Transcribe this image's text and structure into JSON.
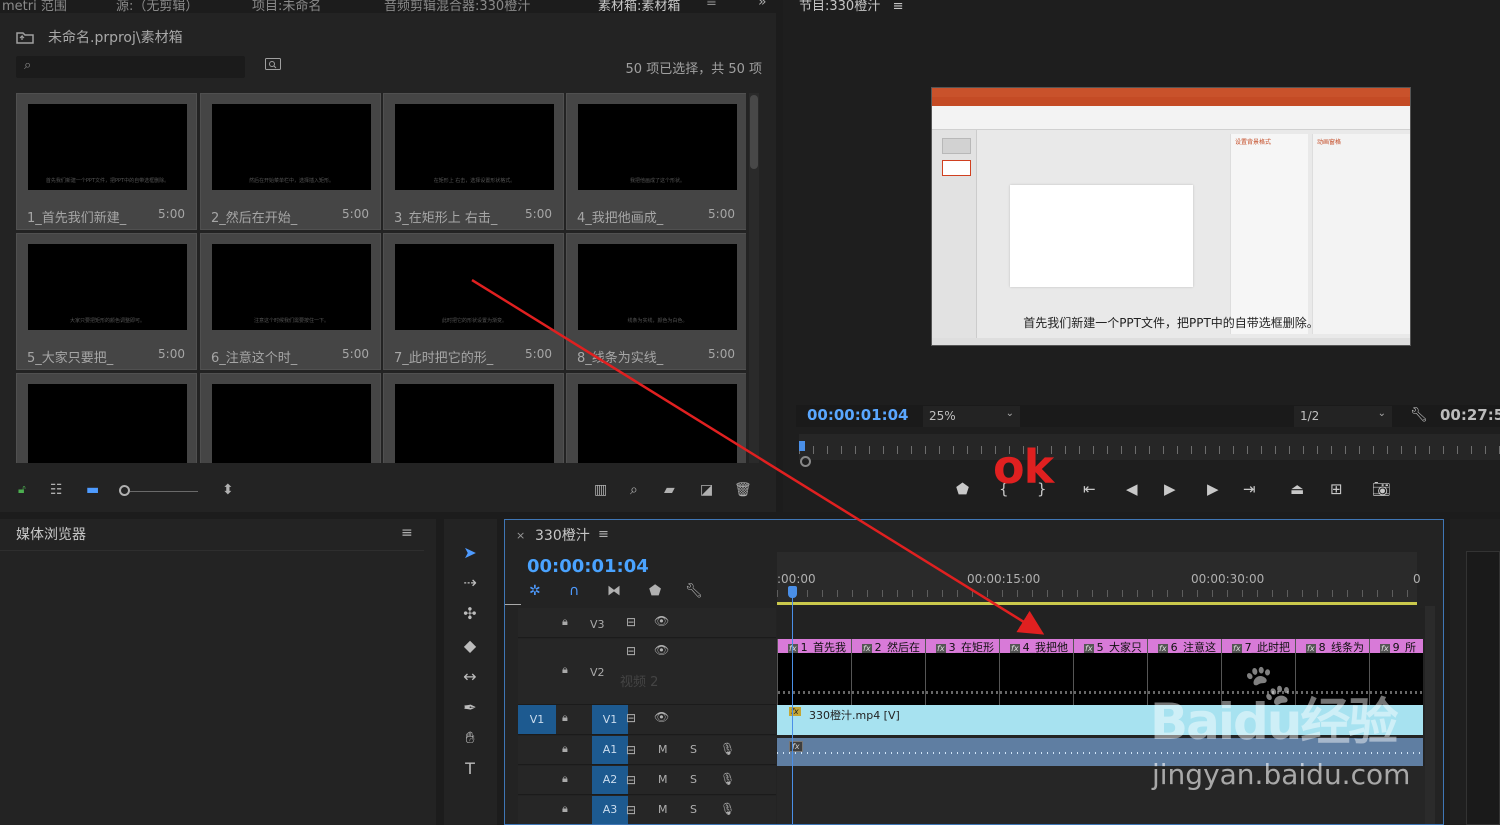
{
  "tabs": [
    {
      "label": "metri 范围"
    },
    {
      "label": "源:（无剪辑）"
    },
    {
      "label": "项目:未命名"
    },
    {
      "label": "音频剪辑混合器:330橙汁"
    },
    {
      "label": "素材箱:素材箱",
      "active": true
    }
  ],
  "tabs_more": "»",
  "tab_menu": "≡",
  "bin": {
    "path": "未命名.prproj\\素材箱",
    "count_text": "50 项已选择，共 50 项",
    "items": [
      {
        "name": "1_首先我们新建_",
        "duration": "5:00",
        "caption": "首先我们新建一个PPT文件，把PPT中的自带选框删除。"
      },
      {
        "name": "2_然后在开始_",
        "duration": "5:00",
        "caption": "然后在开始菜单栏中，选择插入矩形。"
      },
      {
        "name": "3_在矩形上 右击_",
        "duration": "5:00",
        "caption": "在矩形上 右击，选择设置形状格式。"
      },
      {
        "name": "4_我把他画成_",
        "duration": "5:00",
        "caption": "我把他画成了这个形状。"
      },
      {
        "name": "5_大家只要把_",
        "duration": "5:00",
        "caption": "大家只要把矩形的颜色调整即可。"
      },
      {
        "name": "6_注意这个时_",
        "duration": "5:00",
        "caption": "注意这个时候我们需要按住一下。"
      },
      {
        "name": "7_此时把它的形_",
        "duration": "5:00",
        "caption": "此时把它的形状设置为渐变。"
      },
      {
        "name": "8_线条为实线_",
        "duration": "5:00",
        "caption": "线条为实线，颜色为白色。"
      },
      {
        "name": "",
        "duration": "",
        "caption": ""
      },
      {
        "name": "",
        "duration": "",
        "caption": ""
      },
      {
        "name": "",
        "duration": "",
        "caption": ""
      },
      {
        "name": "",
        "duration": "",
        "caption": ""
      }
    ]
  },
  "program": {
    "title": "节目:330橙汁",
    "subtitle": "首先我们新建一个PPT文件，把PPT中的自带选框删除。",
    "ppt_pane_title": "设置背景格式",
    "ppt_pane2_title": "动画窗格",
    "timecode": "00:00:01:04",
    "zoom": "25%",
    "resolution": "1/2",
    "duration": "00:27:5"
  },
  "media_browser": {
    "title": "媒体浏览器",
    "menu": "≡"
  },
  "timeline": {
    "close": "×",
    "name": "330橙汁",
    "menu": "≡",
    "timecode": "00:00:01:04",
    "ruler_labels": [
      ":00:00",
      "00:00:15:00",
      "00:00:30:00",
      "0"
    ],
    "tracks": {
      "v3": "V3",
      "v2": "V2",
      "v1": "V1",
      "v1_src": "V1",
      "a1": "A1",
      "a2": "A2",
      "a3": "A3",
      "v2_ghost": "视频 2",
      "m": "M",
      "s": "S"
    },
    "v2_clips": [
      "1_首先我",
      "2_然后在",
      "3_在矩形",
      "4_我把他",
      "5_大家只",
      "6_注意这",
      "7_此时把",
      "8_线条为",
      "9_所"
    ],
    "fx_label": "fx",
    "v1_clip_label": "330橙汁.mp4 [V]"
  },
  "annotation": {
    "text": "ok",
    "color": "#e02020"
  },
  "watermark": {
    "logo": "Baidu经验",
    "url": "jingyan.baidu.com"
  },
  "colors": {
    "accent_blue": "#4aa3ff",
    "clip_pink": "#d87ad8",
    "clip_cyan": "#a7e2f0",
    "audio_blue": "#5f7ea2",
    "workbar": "#cbc94c"
  }
}
